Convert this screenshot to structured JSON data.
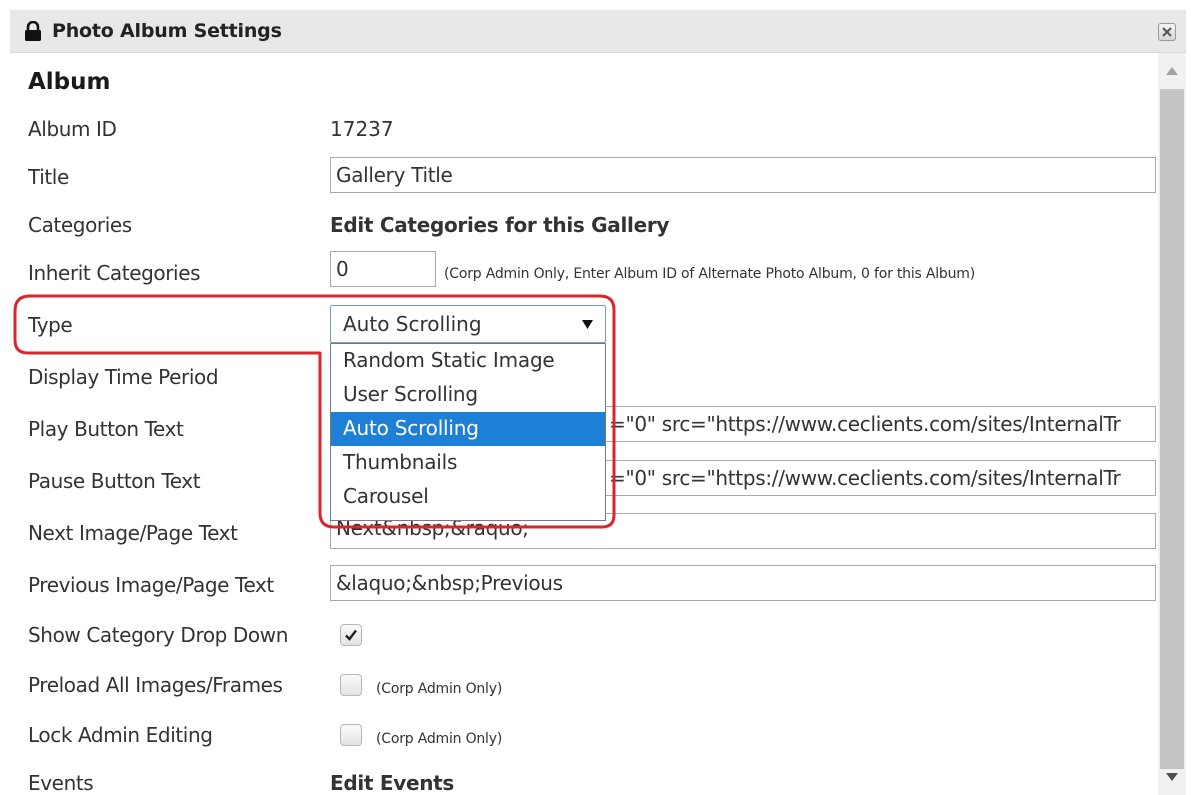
{
  "dialog": {
    "title": "Photo Album Settings",
    "icons": {
      "title_icon": "lock-icon",
      "close": "close-icon"
    }
  },
  "section": {
    "title": "Album"
  },
  "fields": {
    "album_id": {
      "label": "Album ID",
      "value": "17237"
    },
    "title": {
      "label": "Title",
      "value": "Gallery Title"
    },
    "categories": {
      "label": "Categories",
      "link": "Edit Categories for this Gallery"
    },
    "inherit_categories": {
      "label": "Inherit Categories",
      "value": "0",
      "hint": "(Corp Admin Only, Enter Album ID of Alternate Photo Album, 0 for this Album)"
    },
    "type": {
      "label": "Type",
      "selected": "Auto Scrolling",
      "options": [
        "Random Static Image",
        "User Scrolling",
        "Auto Scrolling",
        "Thumbnails",
        "Carousel"
      ]
    },
    "display_time_period": {
      "label": "Display Time Period"
    },
    "play_button_text": {
      "label": "Play Button Text",
      "value": "=\"0\" src=\"https://www.ceclients.com/sites/InternalTr"
    },
    "pause_button_text": {
      "label": "Pause Button Text",
      "value": "=\"0\" src=\"https://www.ceclients.com/sites/InternalTr"
    },
    "next_text": {
      "label": "Next Image/Page Text",
      "value": "Next&nbsp;&raquo;"
    },
    "previous_text": {
      "label": "Previous Image/Page Text",
      "value": "&laquo;&nbsp;Previous"
    },
    "show_category_drop_down": {
      "label": "Show Category Drop Down",
      "checked": true
    },
    "preload_all": {
      "label": "Preload All Images/Frames",
      "checked": false,
      "hint": "(Corp Admin Only)"
    },
    "lock_admin_editing": {
      "label": "Lock Admin Editing",
      "checked": false,
      "hint": "(Corp Admin Only)"
    },
    "events": {
      "label": "Events",
      "link": "Edit Events"
    }
  },
  "colors": {
    "highlight_outline": "#d9262c",
    "selected_option": "#1e7fd6",
    "titlebar": "#e8e8e8"
  }
}
